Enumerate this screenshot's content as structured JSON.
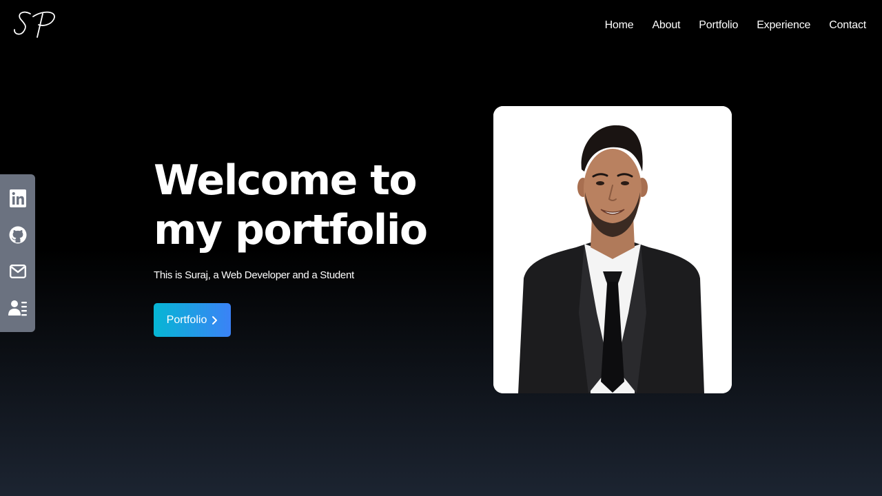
{
  "logo": {
    "text": "SP"
  },
  "nav": {
    "items": [
      {
        "label": "Home"
      },
      {
        "label": "About"
      },
      {
        "label": "Portfolio"
      },
      {
        "label": "Experience"
      },
      {
        "label": "Contact"
      }
    ]
  },
  "socials": [
    {
      "icon": "linkedin-icon"
    },
    {
      "icon": "github-icon"
    },
    {
      "icon": "mail-icon"
    },
    {
      "icon": "resume-icon"
    }
  ],
  "hero": {
    "title": "Welcome to my portfolio",
    "subtitle": "This is Suraj, a Web Developer and a Student",
    "button_label": "Portfolio",
    "button_icon": "chevron-right-icon"
  },
  "colors": {
    "background_top": "#000000",
    "background_bottom": "#1c2431",
    "social_bar": "#6b7280",
    "button_gradient_start": "#06b6d4",
    "button_gradient_end": "#3b82f6"
  }
}
